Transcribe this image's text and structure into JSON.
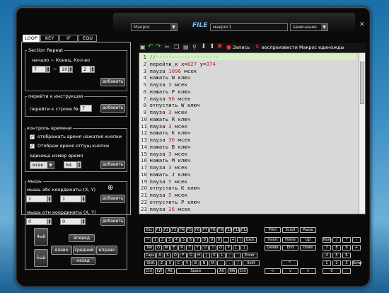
{
  "topbar": {
    "macro_select": "Макрос",
    "file_label": "FILE",
    "macro_name": "макрос1",
    "comment_select": "замечание",
    "close": "✕"
  },
  "tabs": [
    "LOOP",
    "KEY",
    "IF",
    "EQU"
  ],
  "toolbar": {
    "record": "Запись",
    "play_once": "воспроизвести Макрос единожды"
  },
  "section_repeat": {
    "title": "Section Repeat",
    "label": "начало ~ Конец, Кол-во",
    "start": "7",
    "tilde": "~",
    "end": "10",
    "count": "2",
    "add": "добавить"
  },
  "goto": {
    "title": "перейти к инструкции",
    "label": "перейти к строке №:",
    "value": "7",
    "add": "добавить"
  },
  "time_control": {
    "title": "контроль времени",
    "opt1": "отображать время нажатия кнопки",
    "opt2": "Отображ время отпущ кнопки",
    "unit_label": "единица измер время",
    "unit": "мсек",
    "value": "64",
    "add": "добавить"
  },
  "mouse": {
    "title": "мышь",
    "abs_label": "мышь абс координаты (X, Y)",
    "abs_x": "1",
    "abs_y": "1",
    "add1": "добавить",
    "rel_label": "мышь отн координаты (X, Y)",
    "rel_x": "0",
    "rel_y": "0",
    "add2": "добавить",
    "b4": "4ый",
    "b5": "5ый",
    "forward": "вперед",
    "left": "влево",
    "middle": "средний",
    "right": "вправо",
    "back": "назад"
  },
  "editor_lines": [
    {
      "n": "1",
      "a": "//",
      "b": "--------------------",
      "c": ""
    },
    {
      "n": "2",
      "a": "перейти_к x=",
      "b": "827",
      "c": " y=",
      "d": "374"
    },
    {
      "n": "3",
      "a": "пауза ",
      "b": "1096",
      "c": " мсек"
    },
    {
      "n": "4",
      "a": "нажать W ключ",
      "b": "",
      "c": ""
    },
    {
      "n": "5",
      "a": "пауза ",
      "b": "3",
      "c": " мсек"
    },
    {
      "n": "6",
      "a": "нажать P ключ",
      "b": "",
      "c": ""
    },
    {
      "n": "7",
      "a": "пауза ",
      "b": "96",
      "c": " мсек"
    },
    {
      "n": "8",
      "a": "отпустить W ключ",
      "b": "",
      "c": ""
    },
    {
      "n": "9",
      "a": "пауза ",
      "b": "3",
      "c": " мсек"
    },
    {
      "n": "10",
      "a": "нажать R ключ",
      "b": "",
      "c": ""
    },
    {
      "n": "11",
      "a": "пауза ",
      "b": "3",
      "c": " мсек"
    },
    {
      "n": "12",
      "a": "нажать K ключ",
      "b": "",
      "c": ""
    },
    {
      "n": "13",
      "a": "пауза ",
      "b": "30",
      "c": " мсек"
    },
    {
      "n": "14",
      "a": "нажать B ключ",
      "b": "",
      "c": ""
    },
    {
      "n": "15",
      "a": "пауза ",
      "b": "3",
      "c": " мсек"
    },
    {
      "n": "16",
      "a": "нажать M ключ",
      "b": "",
      "c": ""
    },
    {
      "n": "17",
      "a": "пауза ",
      "b": "3",
      "c": " мсек"
    },
    {
      "n": "18",
      "a": "нажать J ключ",
      "b": "",
      "c": ""
    },
    {
      "n": "19",
      "a": "пауза ",
      "b": "5",
      "c": " мсек"
    },
    {
      "n": "20",
      "a": "отпустить K ключ",
      "b": "",
      "c": ""
    },
    {
      "n": "21",
      "a": "пауза ",
      "b": "5",
      "c": " мсек"
    },
    {
      "n": "22",
      "a": "отпустить P ключ",
      "b": "",
      "c": ""
    },
    {
      "n": "23",
      "a": "пауза ",
      "b": "26",
      "c": " мсек"
    }
  ],
  "keyboard": {
    "fn_row": [
      "Esc",
      "F1",
      "F2",
      "F3",
      "F4",
      "F5",
      "F6",
      "F7",
      "F8",
      "F9",
      "F10",
      "F11",
      "F12"
    ],
    "sys": [
      "Print",
      "Scroll",
      "Pause"
    ],
    "num_row": [
      "~",
      "1",
      "2",
      "3",
      "4",
      "5",
      "6",
      "7",
      "8",
      "9",
      "0",
      "_",
      "+",
      "\\",
      "back"
    ],
    "q_row": [
      "Tab",
      "Q",
      "W",
      "E",
      "R",
      "T",
      "Y",
      "U",
      "I",
      "O",
      "P",
      "[",
      "]"
    ],
    "a_row": [
      "Caps",
      "A",
      "S",
      "D",
      "F",
      "G",
      "H",
      "J",
      "K",
      "L",
      ";",
      "'",
      "Enter"
    ],
    "z_row": [
      "Shift",
      "Z",
      "X",
      "C",
      "V",
      "B",
      "N",
      "M",
      ",",
      ".",
      "/",
      "Shift"
    ],
    "bottom": [
      "Ctrl",
      "LW",
      "Alt",
      "Space",
      "Alt",
      "RW",
      "Ctrl"
    ],
    "nav1": [
      "Insert",
      "Home",
      "Up"
    ],
    "nav2": [
      "Delete",
      "End",
      "Down"
    ],
    "arrows": [
      "^",
      "<",
      "v",
      ">"
    ],
    "np1": [
      "Num",
      "/",
      "*",
      "-"
    ],
    "np2": [
      "7",
      "8",
      "9",
      "+"
    ],
    "np3": [
      "4",
      "5",
      "6"
    ],
    "np4": [
      "1",
      "2",
      "3",
      "Enter"
    ],
    "np5": [
      "0",
      "."
    ]
  }
}
